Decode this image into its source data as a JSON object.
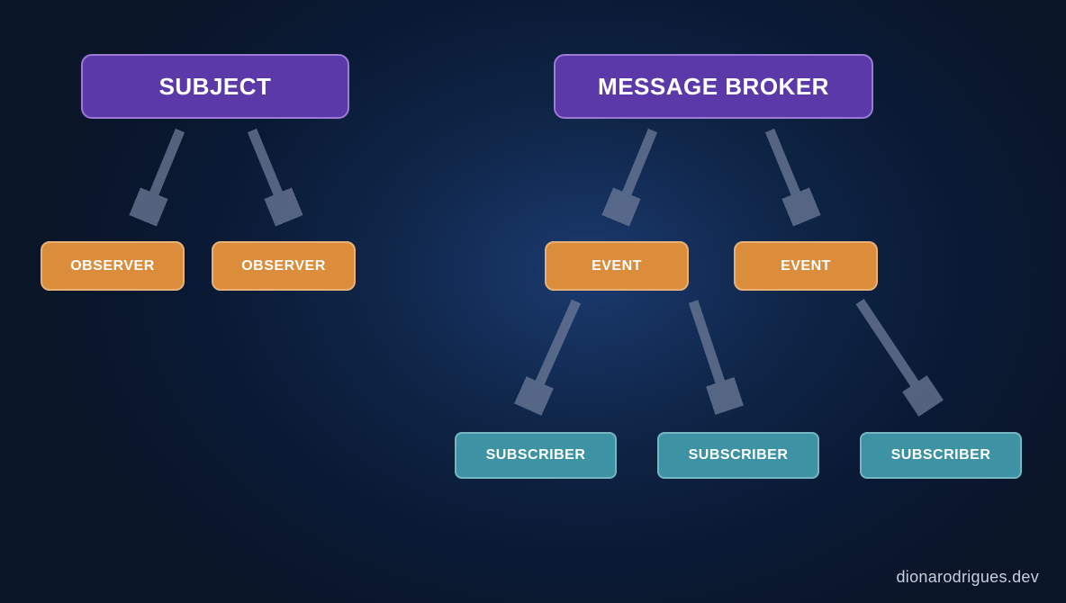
{
  "left": {
    "top": {
      "label": "SUBJECT"
    },
    "children": [
      {
        "label": "OBSERVER"
      },
      {
        "label": "OBSERVER"
      }
    ]
  },
  "right": {
    "top": {
      "label": "MESSAGE BROKER"
    },
    "middle": [
      {
        "label": "EVENT"
      },
      {
        "label": "EVENT"
      }
    ],
    "bottom": [
      {
        "label": "SUBSCRIBER"
      },
      {
        "label": "SUBSCRIBER"
      },
      {
        "label": "SUBSCRIBER"
      }
    ]
  },
  "attribution": "dionarodrigues.dev",
  "colors": {
    "purple_fill": "#5b39a8",
    "purple_border": "#9b7bd4",
    "orange_fill": "#db8d3c",
    "orange_border": "#e8b178",
    "teal_fill": "#3d93a3",
    "teal_border": "#76b5c2",
    "arrow": "#6d7b99"
  }
}
